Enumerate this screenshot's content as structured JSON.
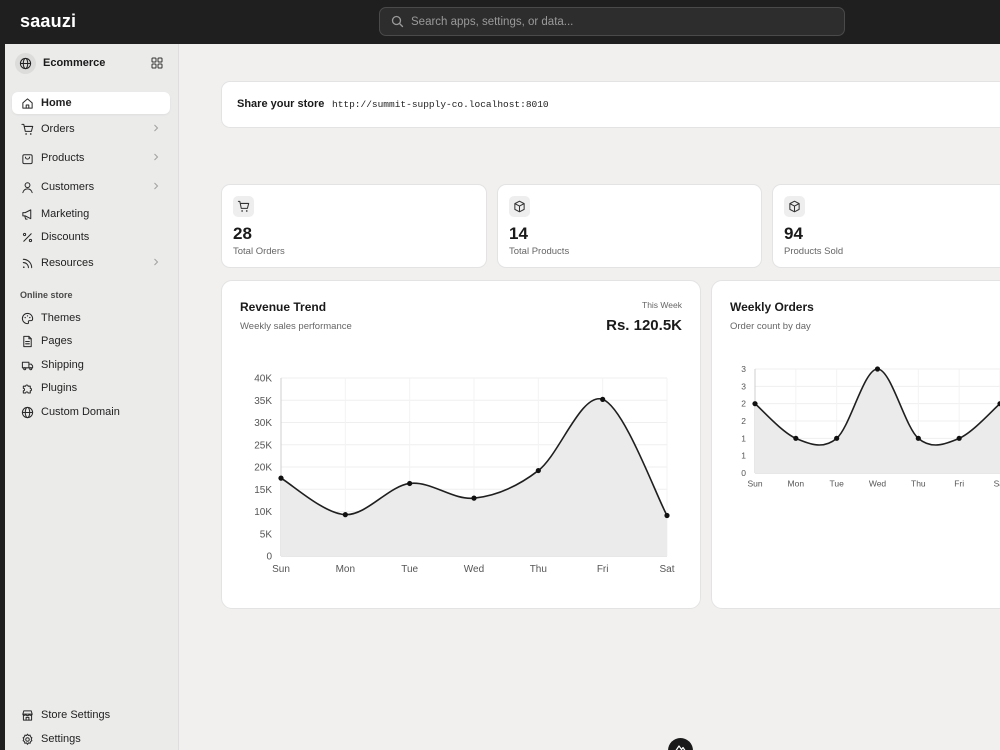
{
  "app": {
    "logo": "saauzi"
  },
  "search": {
    "placeholder": "Search apps, settings, or data..."
  },
  "sidebar": {
    "store_name": "Ecommerce",
    "items": [
      {
        "label": "Home",
        "icon": "home-icon",
        "active": true,
        "chevron": false
      },
      {
        "label": "Orders",
        "icon": "cart-icon",
        "active": false,
        "chevron": true
      },
      {
        "label": "Products",
        "icon": "bag-icon",
        "active": false,
        "chevron": true
      },
      {
        "label": "Customers",
        "icon": "user-icon",
        "active": false,
        "chevron": true
      },
      {
        "label": "Marketing",
        "icon": "megaphone-icon",
        "active": false,
        "chevron": false
      },
      {
        "label": "Discounts",
        "icon": "percent-icon",
        "active": false,
        "chevron": false
      },
      {
        "label": "Resources",
        "icon": "rss-icon",
        "active": false,
        "chevron": true
      }
    ],
    "section_label": "Online store",
    "store_items": [
      {
        "label": "Themes",
        "icon": "palette-icon"
      },
      {
        "label": "Pages",
        "icon": "page-icon"
      },
      {
        "label": "Shipping",
        "icon": "truck-icon"
      },
      {
        "label": "Plugins",
        "icon": "puzzle-icon"
      },
      {
        "label": "Custom Domain",
        "icon": "globe-icon"
      }
    ],
    "bottom_items": [
      {
        "label": "Store Settings",
        "icon": "store-icon"
      },
      {
        "label": "Settings",
        "icon": "gear-icon"
      }
    ]
  },
  "share": {
    "title": "Share your store",
    "url": "http://summit-supply-co.localhost:8010"
  },
  "stats": [
    {
      "value": "28",
      "label": "Total Orders",
      "icon": "cart-icon"
    },
    {
      "value": "14",
      "label": "Total Products",
      "icon": "box-icon"
    },
    {
      "value": "94",
      "label": "Products Sold",
      "icon": "box-icon"
    }
  ],
  "revenue": {
    "title": "Revenue Trend",
    "subtitle": "Weekly sales performance",
    "period": "This Week",
    "total": "Rs. 120.5K"
  },
  "orders": {
    "title": "Weekly Orders",
    "subtitle": "Order count by day"
  },
  "chart_data": [
    {
      "type": "line",
      "title": "Revenue Trend",
      "categories": [
        "Sun",
        "Mon",
        "Tue",
        "Wed",
        "Thu",
        "Fri",
        "Sat"
      ],
      "values": [
        17500,
        9300,
        16300,
        13000,
        19200,
        35200,
        9100
      ],
      "ylim": [
        0,
        40000
      ],
      "yticks": [
        "0",
        "5K",
        "10K",
        "15K",
        "20K",
        "25K",
        "30K",
        "35K",
        "40K"
      ],
      "grid": true,
      "area_fill": true
    },
    {
      "type": "line",
      "title": "Weekly Orders",
      "categories": [
        "Sun",
        "Mon",
        "Tue",
        "Wed",
        "Thu",
        "Fri",
        "Sat"
      ],
      "values": [
        4,
        2,
        2,
        6,
        2,
        2,
        4
      ],
      "yticks": [
        "0",
        "1",
        "1",
        "2",
        "2",
        "3",
        "3"
      ],
      "grid": true,
      "area_fill": true
    }
  ]
}
